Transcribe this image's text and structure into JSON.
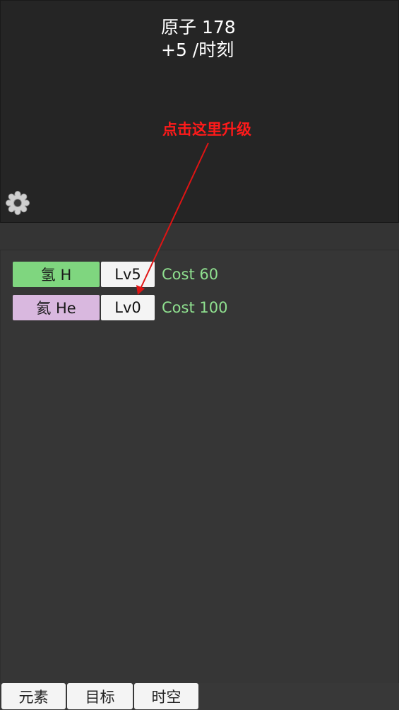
{
  "header": {
    "atoms_line": "原子 178",
    "rate_line": "+5 /时刻"
  },
  "settings": {
    "icon": "gear-icon"
  },
  "elements": [
    {
      "name": "氢 H",
      "level": "Lv5",
      "cost": "Cost 60",
      "color": "#7fd67f"
    },
    {
      "name": "氦 He",
      "level": "Lv0",
      "cost": "Cost 100",
      "color": "#d9b8df"
    }
  ],
  "annotation": {
    "text": "点击这里升级",
    "color": "#ff1a1a"
  },
  "tabs": [
    {
      "label": "元素"
    },
    {
      "label": "目标"
    },
    {
      "label": "时空"
    }
  ],
  "colors": {
    "cost_text": "#8fe08f",
    "top_panel_bg": "#252525",
    "main_bg": "#363636"
  }
}
